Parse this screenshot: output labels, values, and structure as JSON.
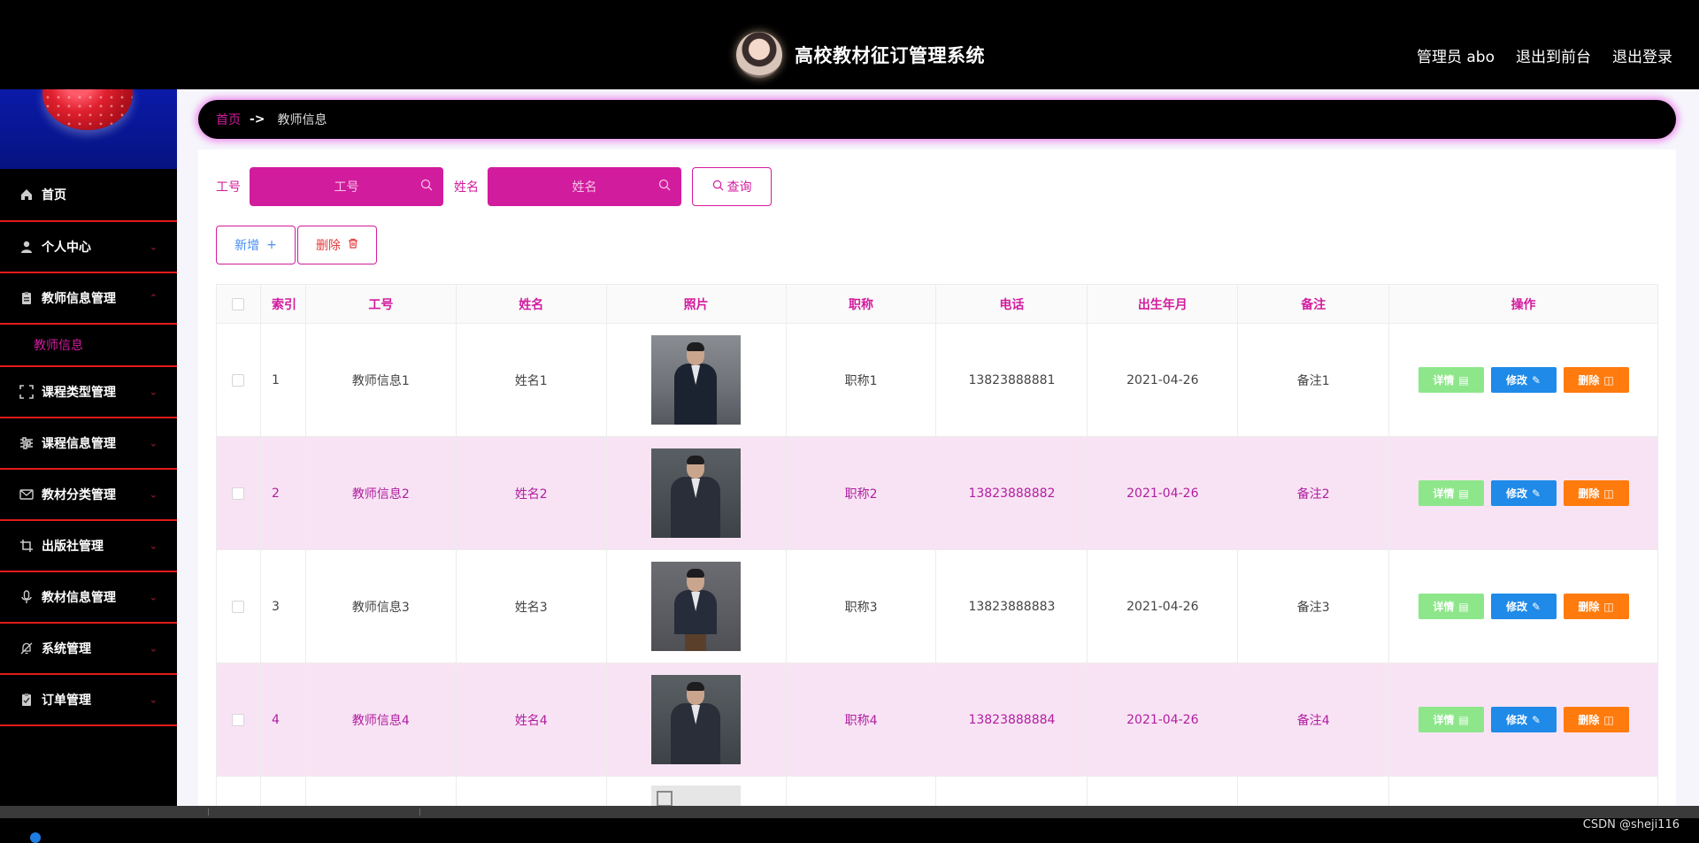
{
  "header": {
    "title": "高校教材征订管理系统",
    "links": [
      "管理员 abo",
      "退出到前台",
      "退出登录"
    ]
  },
  "sidebar": {
    "items": [
      {
        "label": "首页",
        "icon": "home-icon"
      },
      {
        "label": "个人中心",
        "icon": "user-icon"
      },
      {
        "label": "教师信息管理",
        "icon": "clipboard-icon",
        "expanded": true,
        "children": [
          "教师信息"
        ]
      },
      {
        "label": "课程类型管理",
        "icon": "fullscreen-icon"
      },
      {
        "label": "课程信息管理",
        "icon": "sliders-icon"
      },
      {
        "label": "教材分类管理",
        "icon": "mail-icon"
      },
      {
        "label": "出版社管理",
        "icon": "crop-icon"
      },
      {
        "label": "教材信息管理",
        "icon": "microphone-icon"
      },
      {
        "label": "系统管理",
        "icon": "bell-off-icon"
      },
      {
        "label": "订单管理",
        "icon": "clipboard-check-icon"
      }
    ]
  },
  "breadcrumb": {
    "home": "首页",
    "separator": "->",
    "current": "教师信息"
  },
  "search": {
    "fields": [
      {
        "label": "工号",
        "placeholder": "工号"
      },
      {
        "label": "姓名",
        "placeholder": "姓名"
      }
    ],
    "query_label": "查询"
  },
  "actions": {
    "add_label": "新增",
    "delete_label": "删除"
  },
  "table": {
    "columns": [
      "索引",
      "工号",
      "姓名",
      "照片",
      "职称",
      "电话",
      "出生年月",
      "备注",
      "操作"
    ],
    "rows": [
      {
        "index": "1",
        "no": "教师信息1",
        "name": "姓名1",
        "title": "职称1",
        "phone": "13823888881",
        "birth": "2021-04-26",
        "note": "备注1"
      },
      {
        "index": "2",
        "no": "教师信息2",
        "name": "姓名2",
        "title": "职称2",
        "phone": "13823888882",
        "birth": "2021-04-26",
        "note": "备注2"
      },
      {
        "index": "3",
        "no": "教师信息3",
        "name": "姓名3",
        "title": "职称3",
        "phone": "13823888883",
        "birth": "2021-04-26",
        "note": "备注3"
      },
      {
        "index": "4",
        "no": "教师信息4",
        "name": "姓名4",
        "title": "职称4",
        "phone": "13823888884",
        "birth": "2021-04-26",
        "note": "备注4"
      }
    ],
    "ops": {
      "detail": "详情",
      "edit": "修改",
      "delete": "删除"
    }
  },
  "footer": {
    "watermark": "CSDN @sheji116"
  },
  "colors": {
    "accent": "#d21c9e",
    "menu_divider": "#e31a1a",
    "detail_btn": "#8ee68b",
    "edit_btn": "#1f8ae8",
    "delete_btn": "#ff7b0d",
    "alt_row": "#f8e3f4"
  }
}
